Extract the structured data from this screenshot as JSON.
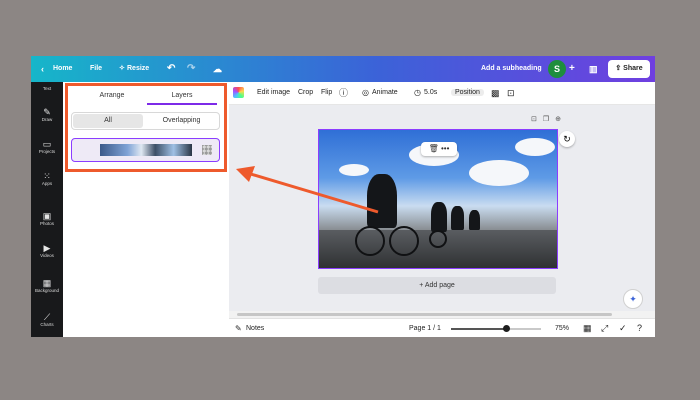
{
  "colors": {
    "accent": "#8b3dff",
    "annotation": "#ee5a2c",
    "rail_bg": "#18191b",
    "share_bg": "#ffffff"
  },
  "topbar": {
    "back_icon": "chevron-left-icon",
    "home_label": "Home",
    "file_label": "File",
    "resize_label": "Resize",
    "undo_icon": "undo-icon",
    "redo_icon": "redo-icon",
    "cloud_icon": "cloud-sync-icon",
    "subheading_label": "Add a subheading",
    "avatar_initial": "S",
    "add_icon": "plus-icon",
    "stats_icon": "bar-chart-icon",
    "share_label": "Share"
  },
  "rail": {
    "items": [
      {
        "label": "Text"
      },
      {
        "label": "Draw"
      },
      {
        "label": "Projects"
      },
      {
        "label": "Apps"
      },
      {
        "label": "Photos"
      },
      {
        "label": "Videos"
      },
      {
        "label": "Background"
      },
      {
        "label": "Charts"
      }
    ]
  },
  "panel": {
    "tabs": [
      {
        "label": "Arrange"
      },
      {
        "label": "Layers"
      }
    ],
    "active_tab": "Layers",
    "filters": [
      {
        "label": "All"
      },
      {
        "label": "Overlapping"
      }
    ],
    "active_filter": "All"
  },
  "toolbar": {
    "edit_image": "Edit image",
    "crop": "Crop",
    "flip": "Flip",
    "info_icon": "info-icon",
    "animate": "Animate",
    "duration": "5.0s",
    "position": "Position",
    "transparency_icon": "checkerboard-icon",
    "lock_icon": "lock-icon"
  },
  "canvas": {
    "add_page_label": "+ Add page",
    "delete_icon": "trash-icon",
    "more_icon": "more-horizontal-icon",
    "rotate_icon": "rotate-icon",
    "magic_icon": "sparkle-icon"
  },
  "bottombar": {
    "notes_label": "Notes",
    "page_label": "Page 1 / 1",
    "zoom_value": "75%",
    "zoom_fraction": 0.62,
    "grid_icon": "grid-view-icon",
    "fullscreen_icon": "fullscreen-icon",
    "check_icon": "check-circle-icon",
    "help_icon": "help-icon"
  }
}
